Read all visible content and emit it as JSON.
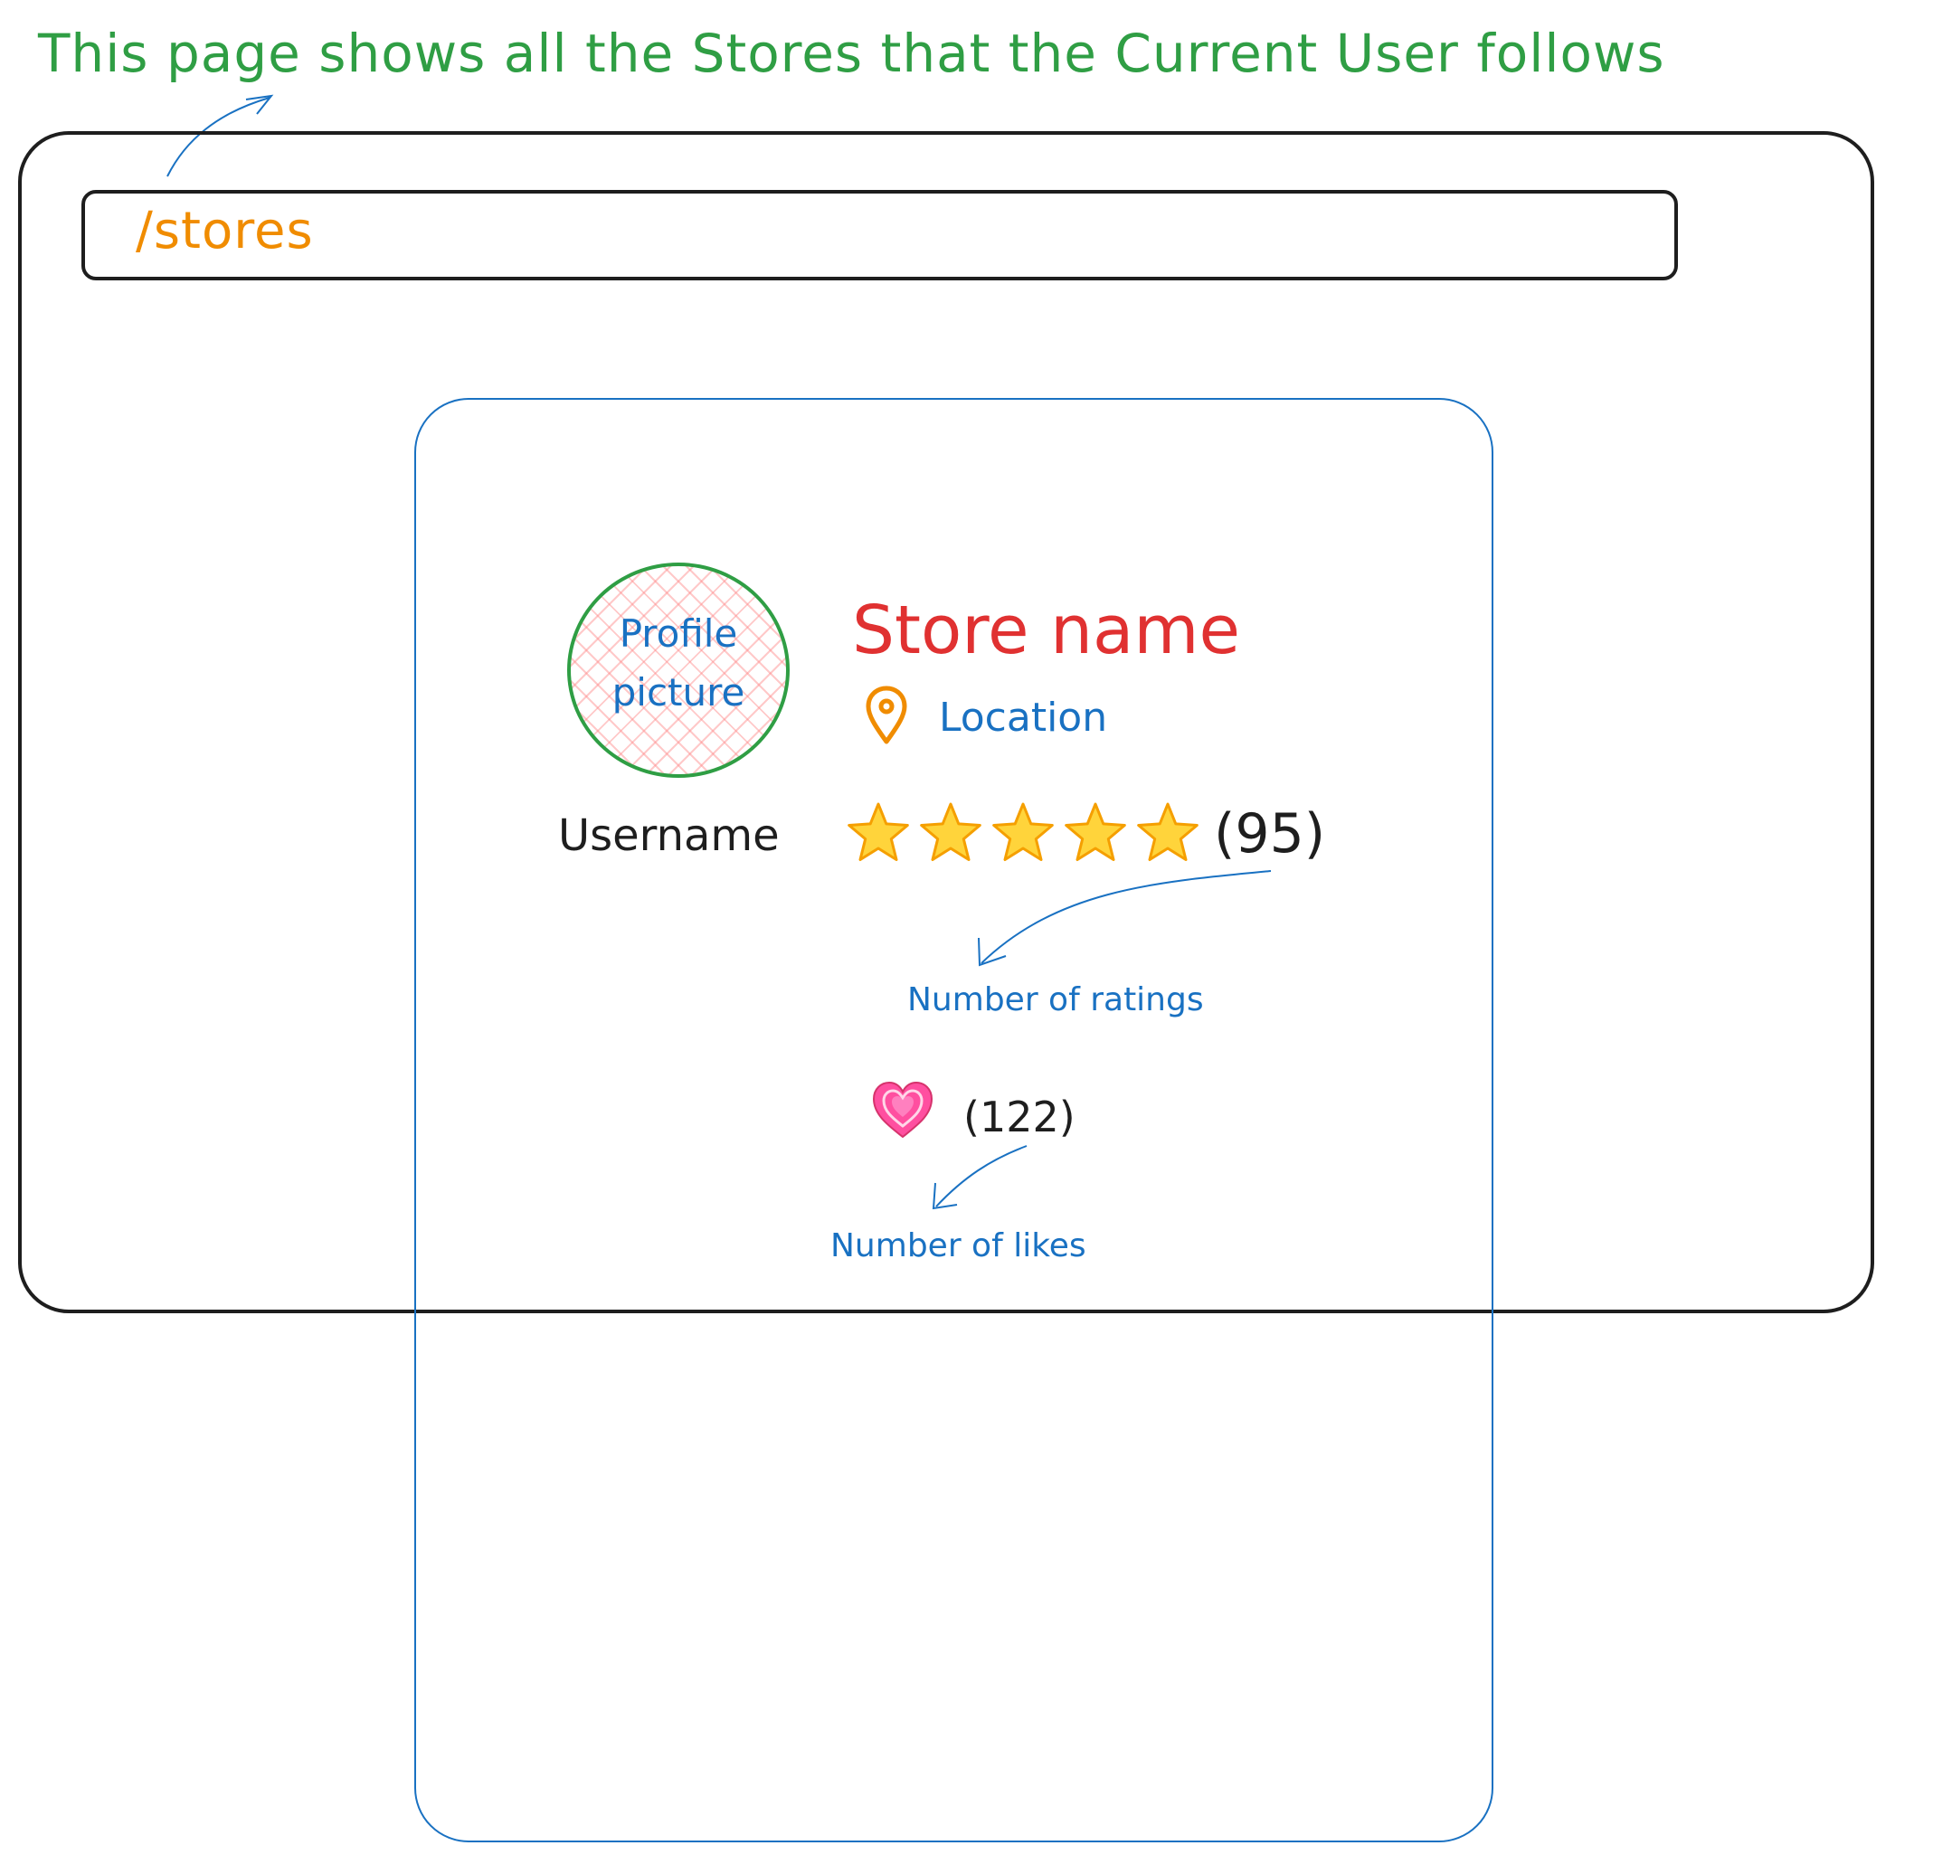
{
  "annotations": {
    "page_description": "This page shows all the Stores that the Current User follows",
    "ratings_note": "Number of ratings",
    "likes_note": "Number of likes"
  },
  "browser": {
    "address": "/stores"
  },
  "store_card": {
    "avatar_label": "Profile\npicture",
    "store_name": "Store name",
    "location": "Location",
    "username": "Username",
    "rating_stars": 5,
    "rating_count": "(95)",
    "likes_count": "(122)"
  },
  "colors": {
    "annotation_green": "#2f9e44",
    "url_orange": "#f08c00",
    "card_blue": "#1971c2",
    "store_name_red": "#e03131",
    "ink": "#1e1e1e"
  },
  "icons": {
    "location": "map-pin-icon",
    "rating": "star-icon",
    "likes": "heart-icon"
  }
}
